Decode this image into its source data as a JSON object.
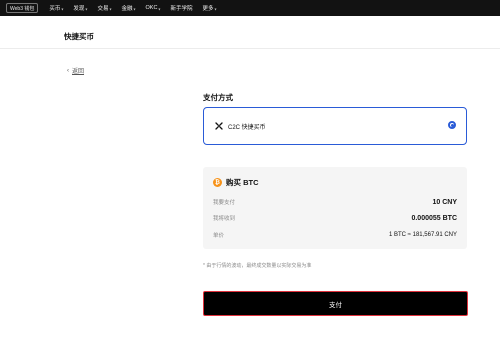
{
  "nav": {
    "web3_badge": "Web3 钱包",
    "items": [
      {
        "label": "买币"
      },
      {
        "label": "发现"
      },
      {
        "label": "交易"
      },
      {
        "label": "金融"
      },
      {
        "label": "OKC"
      },
      {
        "label": "新手学院"
      },
      {
        "label": "更多"
      }
    ]
  },
  "page": {
    "title": "快捷买币"
  },
  "back": {
    "label": "返回"
  },
  "payment": {
    "section_title": "支付方式",
    "method_label": "C2C 快捷买币",
    "selected": true
  },
  "summary": {
    "title": "购买 BTC",
    "rows": [
      {
        "key": "我要支付",
        "value": "10 CNY"
      },
      {
        "key": "我将收到",
        "value": "0.000055 BTC"
      },
      {
        "key": "单价",
        "value": "1 BTC ≈ 181,567.91 CNY"
      }
    ]
  },
  "note": "* 由于行情的波动，最终成交数量以实际交易为准",
  "pay_button": "支付",
  "colors": {
    "accent": "#2a5bd7",
    "btc": "#f7931a",
    "nav_bg": "#121212",
    "button_border": "#e0323c"
  }
}
